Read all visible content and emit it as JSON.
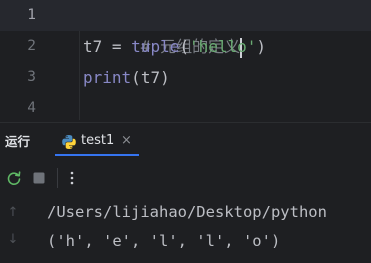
{
  "editor": {
    "lines": [
      {
        "num": "1",
        "comment": "# 元组的定义"
      },
      {
        "num": "2",
        "var": "t7",
        "eq": " = ",
        "func": "tuple",
        "open": "(",
        "str": "'hello'",
        "close": ")"
      },
      {
        "num": "3",
        "func": "print",
        "open": "(",
        "arg": "t7",
        "close": ")"
      },
      {
        "num": "4"
      }
    ]
  },
  "run_panel": {
    "title": "运行",
    "tab_label": "test1",
    "tab_close": "×"
  },
  "toolbar": {
    "icons": [
      "rerun-icon",
      "stop-icon",
      "more-icon"
    ]
  },
  "console": {
    "lines": [
      "/Users/lijiahao/Desktop/python",
      "('h', 'e', 'l', 'l', 'o')"
    ]
  },
  "colors": {
    "background": "#1e1f22",
    "active_line": "#26282e",
    "comment": "#7a7e85",
    "builtin": "#8888c6",
    "string": "#6aab73",
    "text": "#bcbec4",
    "tab_underline": "#3574f0"
  }
}
